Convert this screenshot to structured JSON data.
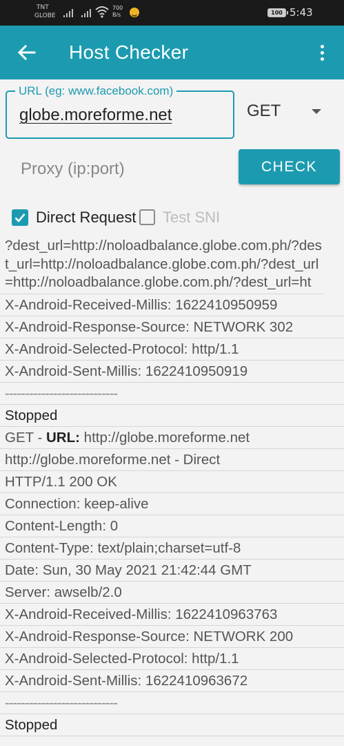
{
  "status_bar": {
    "carrier_line1": "TNT",
    "carrier_line2": "GLOBE",
    "speed_value": "700",
    "speed_unit": "B/s",
    "battery": "100",
    "time": "5:43"
  },
  "app_bar": {
    "title": "Host Checker",
    "back_icon": "arrow-back-icon",
    "menu_icon": "more-vert-icon"
  },
  "form": {
    "url_label": "URL (eg: www.facebook.com)",
    "url_value": "globe.moreforme.net",
    "method_selected": "GET",
    "proxy_placeholder": "Proxy (ip:port)",
    "check_label": "CHECK",
    "direct_request_label": "Direct Request",
    "direct_request_checked": true,
    "test_sni_label": "Test SNI",
    "test_sni_checked": false
  },
  "colors": {
    "accent": "#1c9bb0",
    "status_bar": "#1a1a1a",
    "background": "#f3f3f3"
  },
  "log": {
    "dest_url_block": "?dest_url=http://noloadbalance.globe.com.ph/?dest_url=http://noloadbalance.globe.com.ph/?dest_url=http://noloadbalance.globe.com.ph/?dest_url=ht",
    "row1": "X-Android-Received-Millis: 1622410950959",
    "row2": "X-Android-Response-Source: NETWORK 302",
    "row3": "X-Android-Selected-Protocol: http/1.1",
    "row4": "X-Android-Sent-Millis: 1622410950919",
    "separator1": "----------------------------",
    "stopped1": "Stopped",
    "request_method": "GET",
    "request_dash": " - ",
    "request_url_label": "URL:",
    "request_url_value": " http://globe.moreforme.net",
    "direct_line": "http://globe.moreforme.net - Direct",
    "status_line": "HTTP/1.1 200 OK",
    "connection": "Connection: keep-alive",
    "content_length": "Content-Length: 0",
    "content_type": "Content-Type: text/plain;charset=utf-8",
    "date": "Date: Sun, 30 May 2021 21:42:44 GMT",
    "server": "Server: awselb/2.0",
    "received_millis": "X-Android-Received-Millis: 1622410963763",
    "response_source": "X-Android-Response-Source: NETWORK 200",
    "selected_protocol": "X-Android-Selected-Protocol: http/1.1",
    "sent_millis": "X-Android-Sent-Millis: 1622410963672",
    "separator2": "----------------------------",
    "stopped2": "Stopped"
  }
}
